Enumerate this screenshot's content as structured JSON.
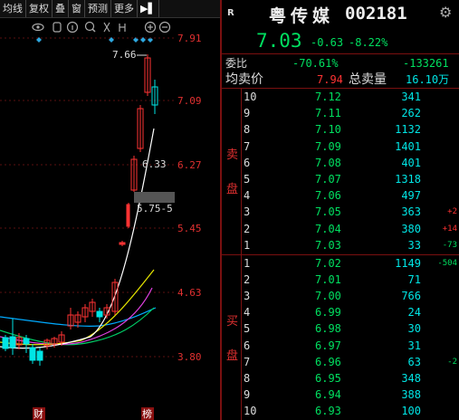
{
  "toolbar": {
    "items": [
      "均线",
      "复权",
      "叠",
      "窗",
      "预测",
      "更多"
    ],
    "pin_icon": "pin-arrow-icon"
  },
  "chart": {
    "icons": [
      "eye-icon",
      "hand-icon",
      "info-icon",
      "search-icon",
      "scissors-icon",
      "link-icon",
      "zoom-in-icon",
      "zoom-out-icon"
    ],
    "y_ticks": [
      "7.91",
      "7.09",
      "6.27",
      "5.45",
      "4.63",
      "3.80"
    ],
    "high_label": "7.66",
    "gap_label_1": "6.33",
    "gap_label_2": "5.75-5",
    "bottom_marks": [
      "财",
      "榜"
    ],
    "colors": {
      "up": "#ff3333",
      "down": "#00e5e5",
      "ma1": "#ffffff",
      "ma2": "#e6e600",
      "ma3": "#e040e0",
      "ma4": "#00cc66",
      "ma5": "#00aaff"
    }
  },
  "header": {
    "r_badge": "R",
    "name": "粤传媒",
    "code": "002181",
    "settings_icon": "gear-icon",
    "price": "7.03",
    "change": "-0.63",
    "change_pct": "-8.22%"
  },
  "summary": {
    "weibi_label": "委比",
    "weibi_value": "-70.61%",
    "weicha_value": "-133261",
    "avg_label": "均卖价",
    "avg_value": "7.94",
    "total_label": "总卖量",
    "total_value": "16.10万"
  },
  "sell": {
    "side_label_1": "卖",
    "side_label_2": "盘",
    "rows": [
      {
        "level": "10",
        "price": "7.12",
        "vol": "341",
        "chg": ""
      },
      {
        "level": "9",
        "price": "7.11",
        "vol": "262",
        "chg": ""
      },
      {
        "level": "8",
        "price": "7.10",
        "vol": "1132",
        "chg": ""
      },
      {
        "level": "7",
        "price": "7.09",
        "vol": "1401",
        "chg": ""
      },
      {
        "level": "6",
        "price": "7.08",
        "vol": "401",
        "chg": ""
      },
      {
        "level": "5",
        "price": "7.07",
        "vol": "1318",
        "chg": ""
      },
      {
        "level": "4",
        "price": "7.06",
        "vol": "497",
        "chg": ""
      },
      {
        "level": "3",
        "price": "7.05",
        "vol": "363",
        "chg": "+2"
      },
      {
        "level": "2",
        "price": "7.04",
        "vol": "380",
        "chg": "+14"
      },
      {
        "level": "1",
        "price": "7.03",
        "vol": "33",
        "chg": "-73"
      }
    ]
  },
  "buy": {
    "side_label_1": "买",
    "side_label_2": "盘",
    "rows": [
      {
        "level": "1",
        "price": "7.02",
        "vol": "1149",
        "chg": "-504"
      },
      {
        "level": "2",
        "price": "7.01",
        "vol": "71",
        "chg": ""
      },
      {
        "level": "3",
        "price": "7.00",
        "vol": "766",
        "chg": ""
      },
      {
        "level": "4",
        "price": "6.99",
        "vol": "24",
        "chg": ""
      },
      {
        "level": "5",
        "price": "6.98",
        "vol": "30",
        "chg": ""
      },
      {
        "level": "6",
        "price": "6.97",
        "vol": "31",
        "chg": ""
      },
      {
        "level": "7",
        "price": "6.96",
        "vol": "63",
        "chg": "-2"
      },
      {
        "level": "8",
        "price": "6.95",
        "vol": "348",
        "chg": ""
      },
      {
        "level": "9",
        "price": "6.94",
        "vol": "388",
        "chg": ""
      },
      {
        "level": "10",
        "price": "6.93",
        "vol": "100",
        "chg": ""
      }
    ]
  }
}
